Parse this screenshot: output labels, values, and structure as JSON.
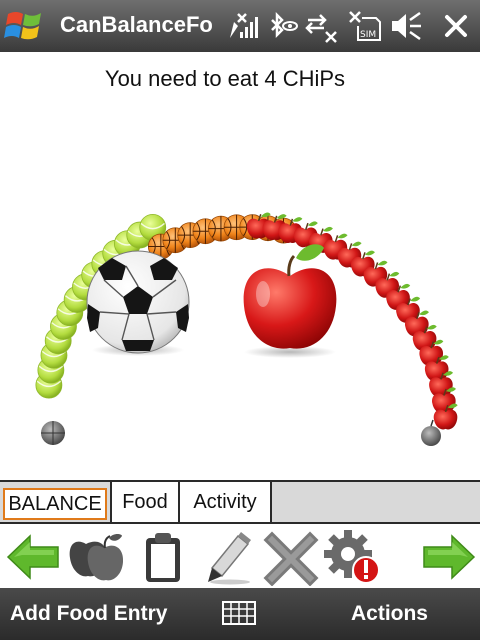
{
  "titlebar": {
    "title": "CanBalanceFor"
  },
  "message": "You need to eat 4 CHiPs",
  "gauge": {
    "chips_needed": 4
  },
  "tabs": [
    {
      "label": "BALANCE",
      "active": true
    },
    {
      "label": "Food",
      "active": false
    },
    {
      "label": "Activity",
      "active": false
    }
  ],
  "softkeys": {
    "left": "Add Food Entry",
    "right": "Actions"
  },
  "colors": {
    "accent": "#e07a1a",
    "tennis": "#b8e04a",
    "basketball": "#f08a1c",
    "apple": "#d01818"
  }
}
